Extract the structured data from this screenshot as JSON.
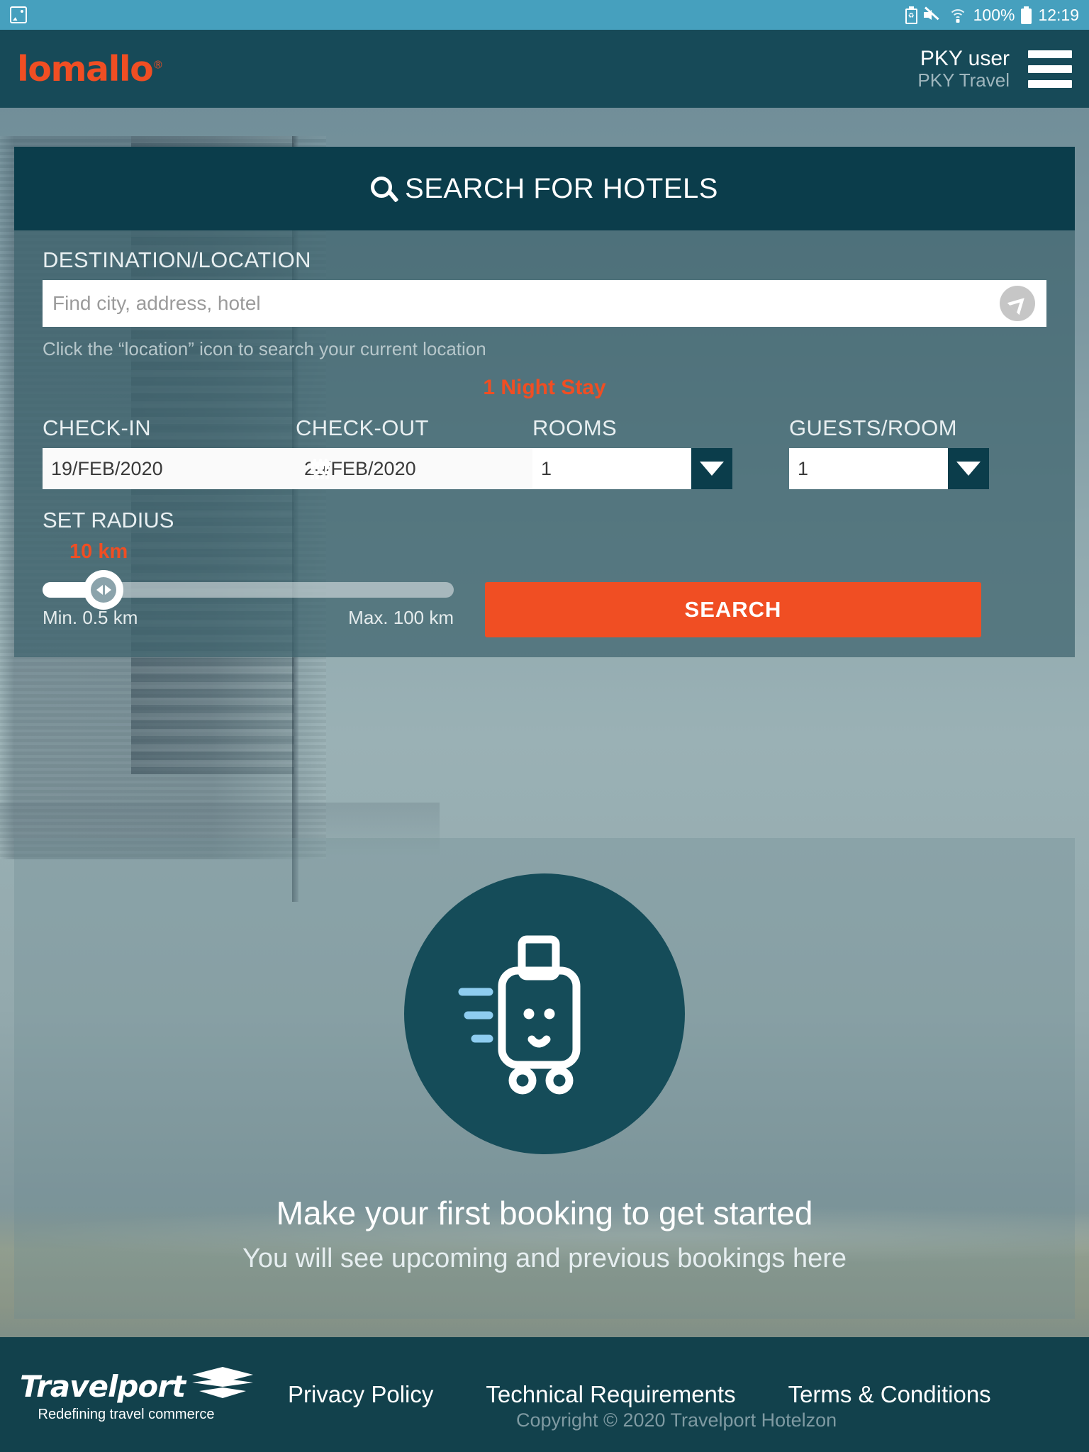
{
  "status_bar": {
    "left_icons": [
      "image-icon"
    ],
    "right_icons": [
      "battery-saver-icon",
      "volume-off-icon",
      "wifi-icon",
      "battery-icon"
    ],
    "battery_percent": "100%",
    "clock": "12:19"
  },
  "header": {
    "logo_text": "lomallo",
    "logo_registered": "®",
    "user_name": "PKY user",
    "user_org": "PKY Travel",
    "menu_icon": "hamburger-menu-icon"
  },
  "search_panel": {
    "title": "SEARCH FOR HOTELS",
    "title_icon": "magnifier-icon",
    "destination": {
      "label": "DESTINATION/LOCATION",
      "placeholder": "Find city, address, hotel",
      "value": "",
      "location_icon": "navigation-arrow-icon",
      "hint": "Click the “location” icon to search your current location"
    },
    "stay_summary": "1 Night Stay",
    "check_in": {
      "label": "CHECK-IN",
      "value": "19/FEB/2020",
      "icon": "calendar-icon"
    },
    "check_out": {
      "label": "CHECK-OUT",
      "value": "20/FEB/2020",
      "icon": "calendar-icon"
    },
    "rooms": {
      "label": "ROOMS",
      "value": "1",
      "icon": "chevron-down-icon"
    },
    "guests": {
      "label": "GUESTS/ROOM",
      "value": "1",
      "icon": "chevron-down-icon"
    },
    "radius": {
      "label": "SET RADIUS",
      "value": "10 km",
      "min_label": "Min. 0.5 km",
      "max_label": "Max. 100 km",
      "min": 0.5,
      "max": 100,
      "current": 10
    },
    "search_button": "SEARCH"
  },
  "empty_state": {
    "illustration": "smiling-suitcase-icon",
    "title": "Make your first booking to get started",
    "subtitle": "You will see upcoming and previous bookings here"
  },
  "footer": {
    "brand": "Travelport",
    "tagline": "Redefining travel commerce",
    "links": [
      {
        "label": "Privacy Policy"
      },
      {
        "label": "Technical Requirements"
      },
      {
        "label": "Terms & Conditions"
      }
    ],
    "copyright": "Copyright © 2020 Travelport Hotelzon"
  },
  "colors": {
    "accent_orange": "#f04e23",
    "header_teal": "#174a58",
    "panel_dark": "#0b3d4b",
    "status_bar": "#46a0be",
    "footer": "#12414c"
  }
}
